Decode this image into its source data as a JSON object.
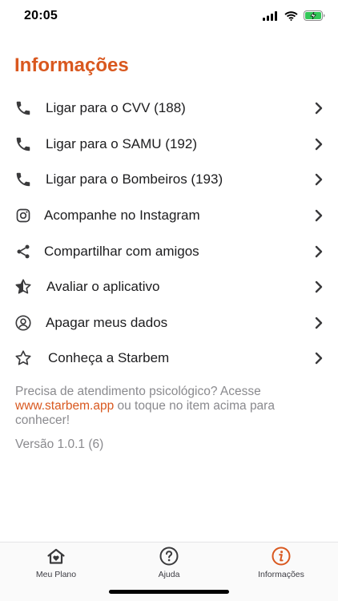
{
  "status_bar": {
    "time": "20:05",
    "icons": [
      "cellular-signal-icon",
      "wifi-icon",
      "battery-charging-icon"
    ]
  },
  "page": {
    "title": "Informações"
  },
  "menu": {
    "items": [
      {
        "label": "Ligar para o CVV (188)",
        "icon": "phone-icon"
      },
      {
        "label": "Ligar para o SAMU (192)",
        "icon": "phone-icon"
      },
      {
        "label": "Ligar para o Bombeiros (193)",
        "icon": "phone-icon"
      },
      {
        "label": "Acompanhe no Instagram",
        "icon": "instagram-icon"
      },
      {
        "label": "Compartilhar com amigos",
        "icon": "share-icon"
      },
      {
        "label": "Avaliar o aplicativo",
        "icon": "star-half-icon"
      },
      {
        "label": "Apagar meus dados",
        "icon": "user-circle-icon"
      },
      {
        "label": "Conheça a Starbem",
        "icon": "star-outline-icon"
      }
    ]
  },
  "info": {
    "text_before": "Precisa de atendimento psicológico? Acesse ",
    "link": "www.starbem.app",
    "text_after": " ou toque no item acima para conhecer!",
    "version": "Versão 1.0.1 (6)"
  },
  "tab_bar": {
    "tabs": [
      {
        "label": "Meu Plano",
        "icon": "home-heart-icon"
      },
      {
        "label": "Ajuda",
        "icon": "help-circle-icon"
      },
      {
        "label": "Informações",
        "icon": "info-circle-icon",
        "active": true
      }
    ]
  },
  "colors": {
    "accent": "#d9581f",
    "text": "#1c1c1e",
    "muted": "#8a8a8e",
    "icon": "#3a3a3c"
  }
}
